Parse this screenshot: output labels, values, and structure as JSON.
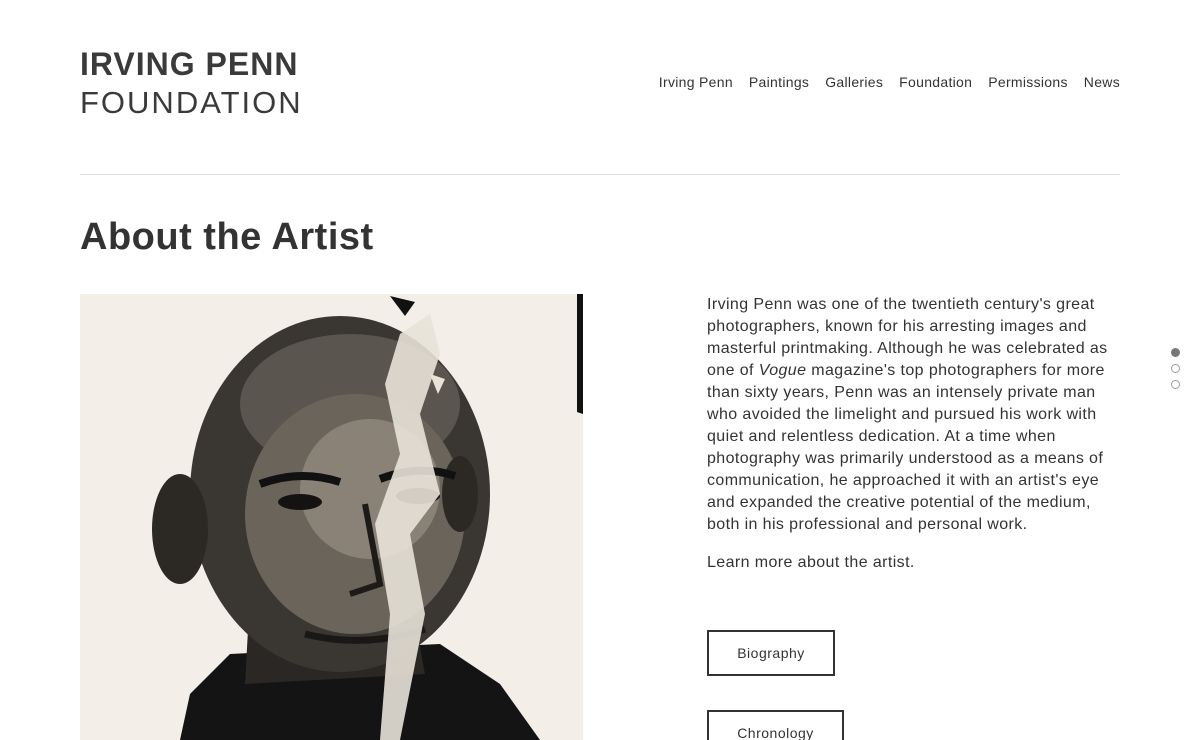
{
  "logo": {
    "line1": "IRVING PENN",
    "line2": "FOUNDATION"
  },
  "nav": {
    "items": [
      "Irving Penn",
      "Paintings",
      "Galleries",
      "Foundation",
      "Permissions",
      "News"
    ]
  },
  "main": {
    "title": "About the Artist",
    "bio_before_em": "Irving Penn was one of the twentieth century's great photographers, known for his arresting images and masterful printmaking. Although he was celebrated as one of ",
    "bio_em": "Vogue",
    "bio_after_em": " magazine's top photographers for more than sixty years, Penn was an intensely private man who avoided the limelight and pursued his work with quiet and relentless dedication. At a time when photography was primarily understood as a means of communication, he approached it with an artist's eye and expanded the creative potential of the medium, both in his professional and personal work.",
    "learn_more": "Learn more about the artist.",
    "buttons": {
      "biography": "Biography",
      "chronology": "Chronology"
    }
  },
  "pager": {
    "count": 3,
    "active_index": 0
  },
  "colors": {
    "text": "#333333",
    "divider": "#dcdcdc",
    "background": "#ffffff"
  }
}
